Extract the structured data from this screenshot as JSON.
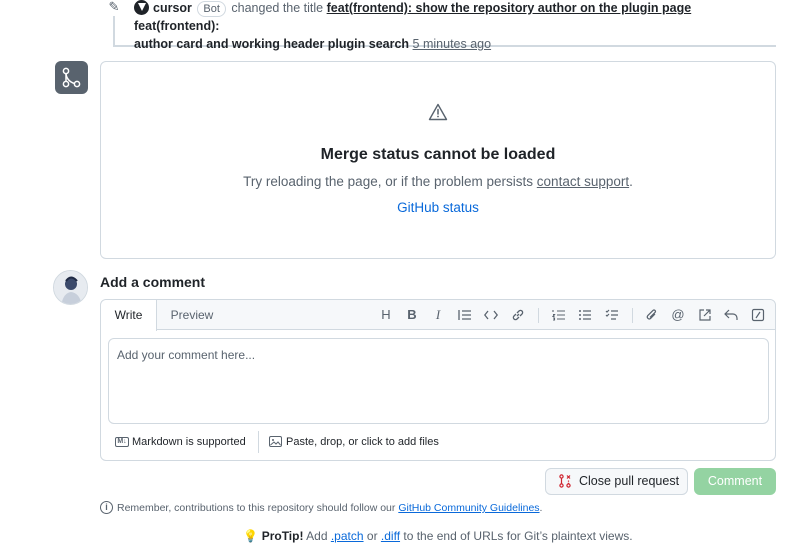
{
  "event": {
    "actor": "cursor",
    "badge": "Bot",
    "action": "changed the title",
    "old_title": "feat(frontend): show the repository author on the plugin page",
    "new_title_part1": "feat(frontend):",
    "new_title_part2": "author card and working header plugin search",
    "time": "5 minutes ago"
  },
  "merge": {
    "title": "Merge status cannot be loaded",
    "message": "Try reloading the page, or if the problem persists",
    "support_link": "contact support",
    "period": ".",
    "status_link": "GitHub status"
  },
  "comment": {
    "heading": "Add a comment",
    "tabs": {
      "write": "Write",
      "preview": "Preview"
    },
    "placeholder": "Add your comment here...",
    "markdown_note": "Markdown is supported",
    "files_note": "Paste, drop, or click to add files",
    "close_button": "Close pull request",
    "comment_button": "Comment",
    "toolbar_icons": [
      "heading-icon",
      "bold-icon",
      "italic-icon",
      "quote-icon",
      "code-icon",
      "link-icon",
      "numbered-list-icon",
      "unordered-list-icon",
      "task-list-icon",
      "attach-icon",
      "mention-icon",
      "cross-reference-icon",
      "saved-reply-icon",
      "slash-command-icon"
    ]
  },
  "footer": {
    "remember_text": "Remember, contributions to this repository should follow our",
    "guidelines_link": "GitHub Community Guidelines",
    "remember_end": ".",
    "protip_label": "ProTip!",
    "protip_text_1": "Add",
    "patch": ".patch",
    "or": "or",
    "diff": ".diff",
    "protip_text_2": "to the end of URLs for Git’s plaintext views."
  },
  "colors": {
    "accent": "#0969da",
    "comment_button": "#94d3a2",
    "close_icon": "#cf222e",
    "icon_gray": "#59636e"
  }
}
